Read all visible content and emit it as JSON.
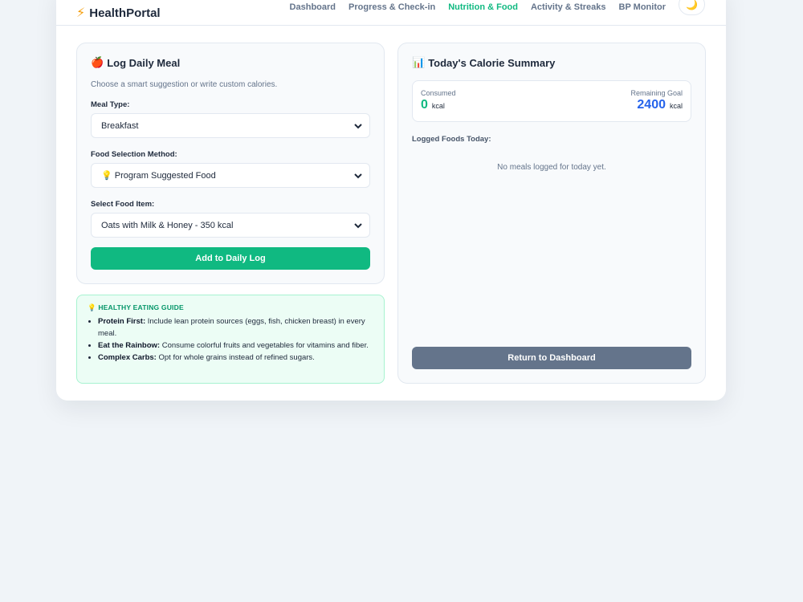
{
  "brand": {
    "icon": "lightning-icon",
    "name": "HealthPortal"
  },
  "nav": {
    "items": [
      {
        "label": "Dashboard",
        "active": false
      },
      {
        "label": "Progress & Check-in",
        "active": false
      },
      {
        "label": "Nutrition & Food",
        "active": true
      },
      {
        "label": "Activity & Streaks",
        "active": false
      },
      {
        "label": "BP Monitor",
        "active": false
      }
    ],
    "theme_toggle_icon": "moon-icon"
  },
  "log_meal": {
    "title": "Log Daily Meal",
    "title_icon": "apple-icon",
    "subtitle": "Choose a smart suggestion or write custom calories.",
    "meal_type_label": "Meal Type:",
    "meal_type_value": "Breakfast",
    "method_label": "Food Selection Method:",
    "method_value": "💡 Program Suggested Food",
    "food_label": "Select Food Item:",
    "food_value": "Oats with Milk & Honey - 350 kcal",
    "add_button": "Add to Daily Log"
  },
  "guide": {
    "title": "💡 HEALTHY EATING GUIDE",
    "items": [
      {
        "bold": "Protein First:",
        "text": " Include lean protein sources (eggs, fish, chicken breast) in every meal."
      },
      {
        "bold": "Eat the Rainbow:",
        "text": " Consume colorful fruits and vegetables for vitamins and fiber."
      },
      {
        "bold": "Complex Carbs:",
        "text": " Opt for whole grains instead of refined sugars."
      }
    ]
  },
  "summary": {
    "title": "Today's Calorie Summary",
    "title_icon": "bar-chart-icon",
    "consumed_label": "Consumed",
    "consumed_value": "0",
    "consumed_unit": "kcal",
    "remaining_label": "Remaining Goal",
    "remaining_value": "2400",
    "remaining_unit": "kcal",
    "logged_label": "Logged Foods Today:",
    "empty_message": "No meals logged for today yet.",
    "return_button": "Return to Dashboard"
  },
  "colors": {
    "accent_green": "#10b981",
    "accent_blue": "#2563eb",
    "secondary_button": "#64748b",
    "guide_bg": "#ecfdf5"
  }
}
